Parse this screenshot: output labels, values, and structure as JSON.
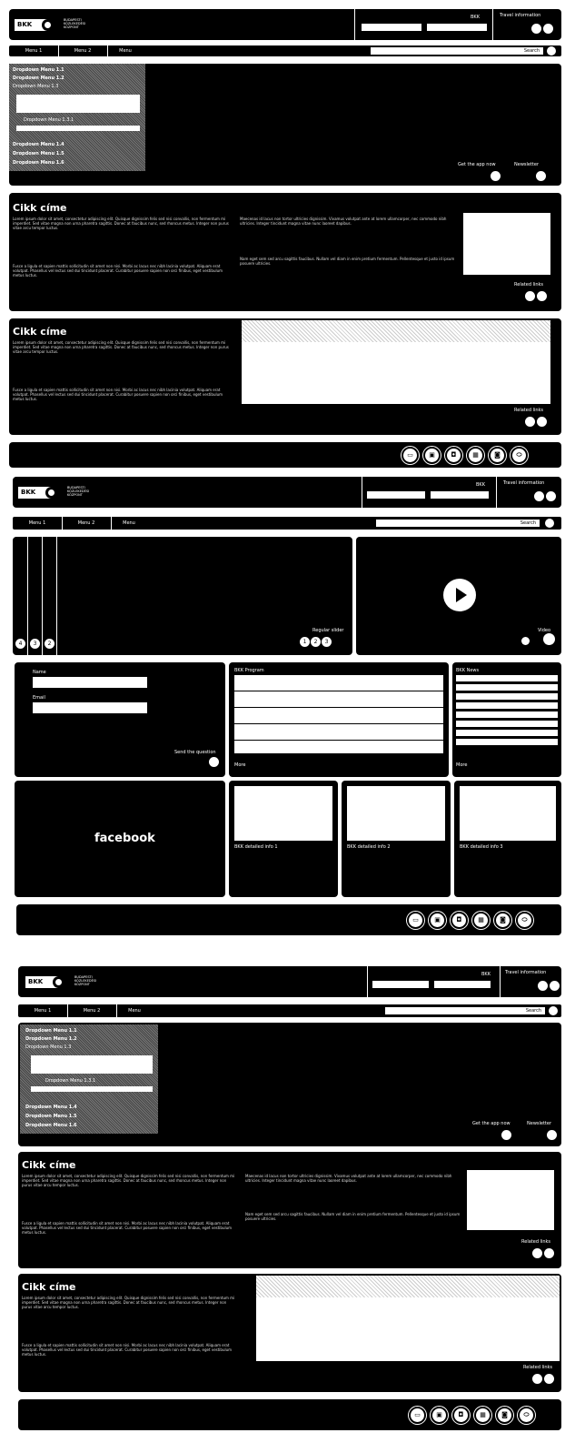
{
  "logo": {
    "brand": "BKK",
    "sub": "BUDAPESTI KÖZLEKEDÉSI KÖZPONT"
  },
  "header": {
    "bkk_label": "BKK",
    "travel_info_label": "Travel information"
  },
  "menu": {
    "tabs": [
      "Menu 1",
      "Menu 2",
      "Menu"
    ],
    "search_placeholder": "Search"
  },
  "dropdown": {
    "items_top": [
      "Dropdown Menu 1.1",
      "Dropdown Menu 1.2",
      "Dropdown Menu 1.3"
    ],
    "sub_item": "Dropdown Menu 1.3.1",
    "items_bottom": [
      "Dropdown Menu 1.4",
      "Dropdown Menu 1.5",
      "Dropdown Menu 1.6"
    ]
  },
  "hero_labels": {
    "left": "Get the app now",
    "right": "Newsletter"
  },
  "article": {
    "title": "Cikk címe",
    "lorem1": "Lorem ipsum dolor sit amet, consectetur adipiscing elit. Quisque dignissim felis sed nisi convallis, non fermentum mi imperdiet. Sed vitae magna non urna pharetra sagittis. Donec at faucibus nunc, sed rhoncus metus. Integer non purus vitae arcu tempor luctus.",
    "lorem2": "Fusce a ligula et sapien mattis sollicitudin sit amet non nisi. Morbi ac lacus nec nibh lacinia volutpat. Aliquam erat volutpat. Phasellus vel lectus sed dui tincidunt placerat. Curabitur posuere sapien non orci finibus, eget vestibulum metus luctus.",
    "lorem3": "Maecenas id lacus non tortor ultricies dignissim. Vivamus volutpat ante at lorem ullamcorper, nec commodo nibh ultricies. Integer tincidunt magna vitae nunc laoreet dapibus.",
    "lorem4": "Nam eget sem sed arcu sagittis faucibus. Nullam vel diam in enim pretium fermentum. Pellentesque et justo id ipsum posuere ultricies.",
    "related": "Related links"
  },
  "page2": {
    "slider_label": "Regular slider",
    "slider_nums": [
      "4",
      "3",
      "2"
    ],
    "slider_dots": [
      "1",
      "2",
      "3"
    ],
    "video_label": "Video",
    "form": {
      "name_label": "Name",
      "email_label": "Email",
      "submit_label": "Send the question"
    },
    "program_label": "BKK Program",
    "program_more": "More",
    "news_label": "BKK News",
    "news_more": "More",
    "facebook": "facebook",
    "cards": [
      "BKK detailed info 1",
      "BKK detailed info 2",
      "BKK detailed info 3"
    ]
  },
  "footer_icons": [
    "bus-icon",
    "tram-icon",
    "trolley-icon",
    "metro-icon",
    "suburban-rail-icon",
    "boat-icon"
  ]
}
